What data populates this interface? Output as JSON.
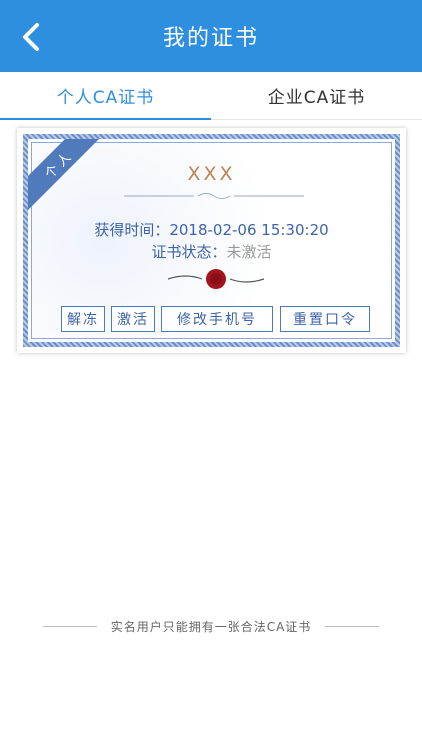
{
  "header": {
    "title": "我的证书"
  },
  "tabs": [
    {
      "label": "个人CA证书",
      "active": true
    },
    {
      "label": "企业CA证书",
      "active": false
    }
  ],
  "certificate": {
    "ribbon": "个人",
    "holder": "XXX",
    "obtained_label": "获得时间：",
    "obtained_value": "2018-02-06 15:30:20",
    "status_label": "证书状态：",
    "status_value": "未激活",
    "buttons": {
      "unfreeze": "解冻",
      "activate": "激活",
      "change_phone": "修改手机号",
      "reset_password": "重置口令"
    }
  },
  "footer": {
    "note": "实名用户只能拥有一张合法CA证书"
  },
  "colors": {
    "accent": "#2e8fe0",
    "certificate_text": "#3d63a8",
    "holder_gold": "#b98453",
    "seal_red": "#a5141d"
  },
  "icons": {
    "back": "chevron-left-icon",
    "seal": "wax-seal-icon"
  }
}
